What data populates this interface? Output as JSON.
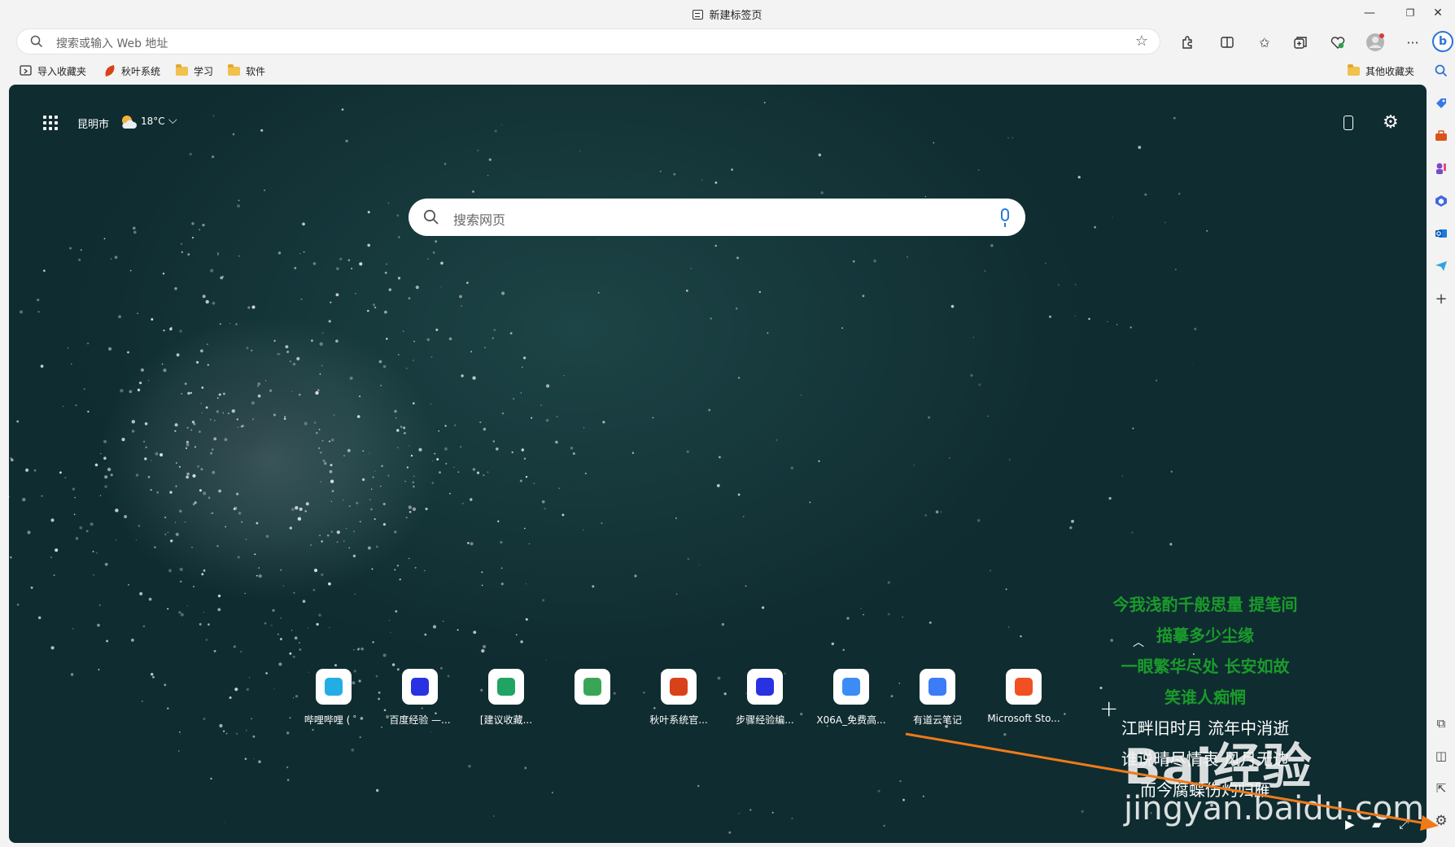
{
  "window": {
    "tab_title": "新建标签页",
    "controls": {
      "minimize": "—",
      "restore": "❐",
      "close": "✕"
    }
  },
  "address_bar": {
    "placeholder": "搜索或输入 Web 地址"
  },
  "bookmarks": {
    "items": [
      {
        "label": "导入收藏夹",
        "icon": "import-icon"
      },
      {
        "label": "秋叶系统",
        "icon": "leaf-icon"
      },
      {
        "label": "学习",
        "icon": "folder-icon"
      },
      {
        "label": "软件",
        "icon": "folder-icon"
      }
    ],
    "other": "其他收藏夹"
  },
  "newtab": {
    "city": "昆明市",
    "temperature": "18°C",
    "search_placeholder": "搜索网页",
    "quick_links": [
      {
        "label": "哔哩哔哩 ( ゜",
        "icon": "bilibili-icon",
        "color": "#23ade5"
      },
      {
        "label": "百度经验 —...",
        "icon": "baidu-icon",
        "color": "#2932e1"
      },
      {
        "label": "[建议收藏...",
        "icon": "sheet-icon",
        "color": "#1fa463"
      },
      {
        "label": "",
        "icon": "grid-app-icon",
        "color": "#3aa655"
      },
      {
        "label": "秋叶系统官...",
        "icon": "leaf-icon",
        "color": "#d8421a"
      },
      {
        "label": "步骤经验编...",
        "icon": "baidu-icon",
        "color": "#2932e1"
      },
      {
        "label": "X06A_免费高...",
        "icon": "baidu-netdisk-icon",
        "color": "#3b8cf5"
      },
      {
        "label": "有道云笔记",
        "icon": "youdao-note-icon",
        "color": "#3b7cf7"
      },
      {
        "label": "Microsoft Sto...",
        "icon": "ms-store-icon",
        "color": "#f25022"
      }
    ]
  },
  "lyrics": {
    "lines": [
      "今我浅酌千般思量 提笔间",
      "描摹多少尘缘",
      "一眼繁华尽处 长安如故",
      "笑谁人痴惘",
      "江畔旧时月 流年中消逝",
      "谁说晴尽情衷 风月无边",
      "而今腐蝶伤灼归雁"
    ]
  },
  "watermark": {
    "logo": "Bai经验",
    "url": "jingyan.baidu.com"
  },
  "colors": {
    "lyric_green": "#1a9b2b",
    "arrow": "#f07a1a",
    "bing_blue": "#2c73d6"
  }
}
